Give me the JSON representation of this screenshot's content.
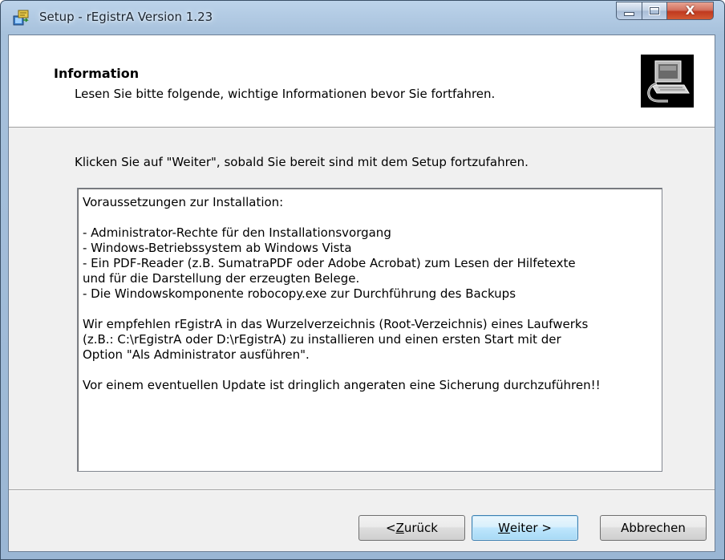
{
  "window": {
    "title": "Setup - rEgistrA Version 1.23",
    "controls": {
      "minimize": "minimize",
      "maximize": "maximize",
      "close": "X"
    }
  },
  "header": {
    "title": "Information",
    "subtitle": "Lesen Sie bitte folgende, wichtige Informationen bevor Sie fortfahren."
  },
  "body": {
    "intro": "Klicken Sie auf \"Weiter\", sobald Sie bereit sind mit dem Setup fortzufahren.",
    "memo_text": "Voraussetzungen zur Installation:\n\n- Administrator-Rechte für den Installationsvorgang\n- Windows-Betriebssystem ab Windows Vista\n- Ein PDF-Reader (z.B. SumatraPDF oder Adobe Acrobat) zum Lesen der Hilfetexte\nund für die Darstellung der erzeugten Belege.\n- Die Windowskomponente robocopy.exe zur Durchführung des Backups\n\nWir empfehlen rEgistrA in das Wurzelverzeichnis (Root-Verzeichnis) eines Laufwerks\n(z.B.: C:\\rEgistrA oder D:\\rEgistrA) zu installieren und einen ersten Start mit der\nOption \"Als Administrator ausführen\".\n\nVor einem eventuellen Update ist dringlich angeraten eine Sicherung durchzuführen!!"
  },
  "buttons": {
    "back_prefix": "< ",
    "back_accel": "Z",
    "back_rest": "urück",
    "next_accel": "W",
    "next_rest": "eiter >",
    "cancel": "Abbrechen"
  },
  "colors": {
    "titlebar": "#a7c1dc",
    "dialog_bg": "#f0f0f0",
    "header_bg": "#ffffff",
    "close_button": "#c0391f",
    "default_button_border": "#3c7fb1"
  }
}
